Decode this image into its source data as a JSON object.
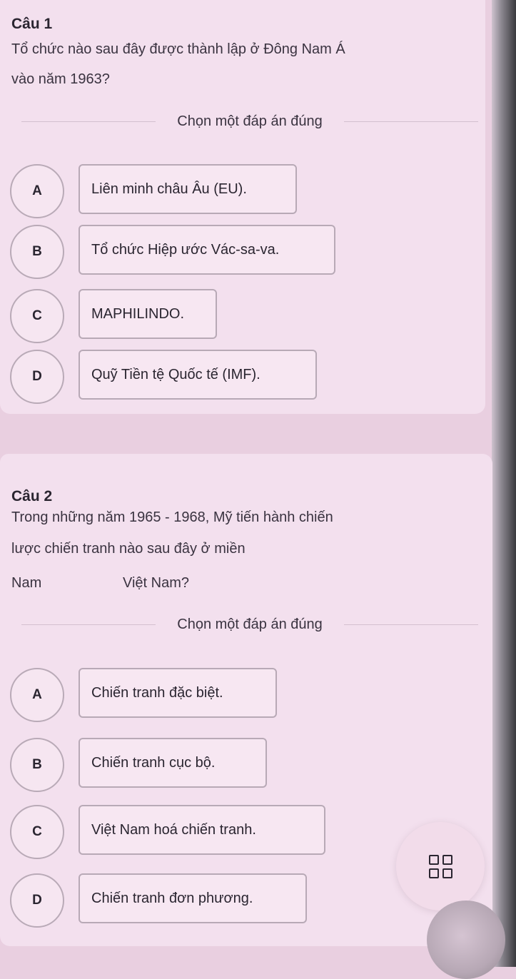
{
  "question1": {
    "title": "Câu 1",
    "text_line1": "Tổ chức nào sau đây được thành lập ở Đông Nam Á",
    "text_line2": "vào năm 1963?",
    "instruction": "Chọn một đáp án đúng",
    "options": [
      {
        "letter": "A",
        "label": "Liên minh châu Âu (EU)."
      },
      {
        "letter": "B",
        "label": "Tổ chức Hiệp ước Vác-sa-va."
      },
      {
        "letter": "C",
        "label": "MAPHILINDO."
      },
      {
        "letter": "D",
        "label": "Quỹ Tiền tệ Quốc tế (IMF)."
      }
    ]
  },
  "question2": {
    "title": "Câu 2",
    "text_line1": "Trong những năm 1965 - 1968, Mỹ tiến hành chiến",
    "text_line2": "lược chiến tranh nào sau đây ở miền",
    "text_line3a": "Nam",
    "text_line3b": "Việt Nam?",
    "instruction": "Chọn một đáp án đúng",
    "options": [
      {
        "letter": "A",
        "label": "Chiến tranh đặc biệt."
      },
      {
        "letter": "B",
        "label": "Chiến tranh cục bộ."
      },
      {
        "letter": "C",
        "label": "Việt Nam hoá chiến tranh."
      },
      {
        "letter": "D",
        "label": "Chiến tranh đơn phương."
      }
    ]
  },
  "floating_button": {
    "icon": "grid-icon"
  }
}
